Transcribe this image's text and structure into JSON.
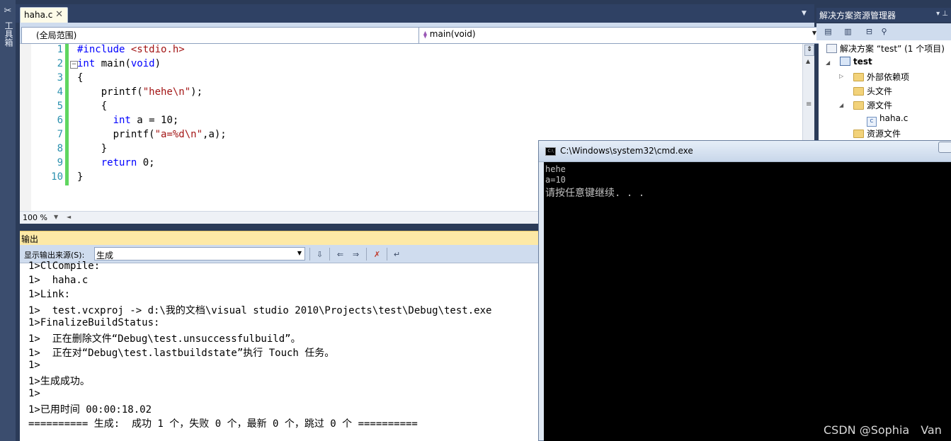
{
  "toolbox": {
    "label": "工具箱"
  },
  "editor": {
    "tab_label": "haha.c",
    "scope_dropdown": "(全局范围)",
    "function_dropdown": "main(void)",
    "zoom": "100 %",
    "line_numbers": [
      "1",
      "2",
      "3",
      "4",
      "5",
      "6",
      "7",
      "8",
      "9",
      "10"
    ],
    "lines": [
      [
        {
          "t": "#include ",
          "c": "kw"
        },
        {
          "t": "<stdio.h>",
          "c": "str"
        }
      ],
      [
        {
          "t": "int",
          "c": "kw"
        },
        {
          "t": " main(",
          "c": ""
        },
        {
          "t": "void",
          "c": "kw"
        },
        {
          "t": ")",
          "c": ""
        }
      ],
      [
        {
          "t": "{",
          "c": ""
        }
      ],
      [
        {
          "t": "    printf(",
          "c": ""
        },
        {
          "t": "\"hehe\\n\"",
          "c": "str"
        },
        {
          "t": ");",
          "c": ""
        }
      ],
      [
        {
          "t": "    {",
          "c": ""
        }
      ],
      [
        {
          "t": "      ",
          "c": ""
        },
        {
          "t": "int",
          "c": "kw"
        },
        {
          "t": " a = 10;",
          "c": ""
        }
      ],
      [
        {
          "t": "      printf(",
          "c": ""
        },
        {
          "t": "\"a=%d\\n\"",
          "c": "str"
        },
        {
          "t": ",a);",
          "c": ""
        }
      ],
      [
        {
          "t": "    }",
          "c": ""
        }
      ],
      [
        {
          "t": "    ",
          "c": ""
        },
        {
          "t": "return",
          "c": "kw"
        },
        {
          "t": " 0;",
          "c": ""
        }
      ],
      [
        {
          "t": "}",
          "c": ""
        }
      ]
    ]
  },
  "output": {
    "title": "输出",
    "source_label": "显示输出来源(S):",
    "source_value": "生成",
    "lines": [
      "1>ClCompile:",
      "1>  haha.c",
      "1>Link:",
      "1>  test.vcxproj -> d:\\我的文档\\visual studio 2010\\Projects\\test\\Debug\\test.exe",
      "1>FinalizeBuildStatus:",
      "1>  正在删除文件“Debug\\test.unsuccessfulbuild”。",
      "1>  正在对“Debug\\test.lastbuildstate”执行 Touch 任务。",
      "1>",
      "1>生成成功。",
      "1>",
      "1>已用时间 00:00:18.02",
      "========== 生成:  成功 1 个，失败 0 个，最新 0 个，跳过 0 个 =========="
    ]
  },
  "solution_explorer": {
    "title": "解决方案资源管理器",
    "solution": "解决方案 “test” (1 个项目)",
    "project": "test",
    "external": "外部依赖项",
    "headers": "头文件",
    "sources": "源文件",
    "file": "haha.c",
    "resources": "资源文件"
  },
  "console": {
    "title": "C:\\Windows\\system32\\cmd.exe",
    "lines": [
      "hehe",
      "a=10",
      "请按任意键继续. . ."
    ]
  },
  "watermark": "CSDN @Sophia　Van"
}
